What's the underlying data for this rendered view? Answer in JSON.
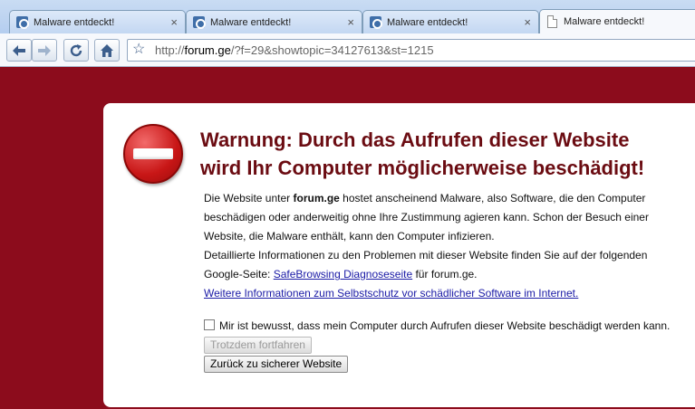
{
  "tabs": [
    {
      "label": "Malware entdeckt!",
      "active": false,
      "close": "×"
    },
    {
      "label": "Malware entdeckt!",
      "active": false,
      "close": "×"
    },
    {
      "label": "Malware entdeckt!",
      "active": false,
      "close": "×"
    },
    {
      "label": "Malware entdeckt!",
      "active": true
    }
  ],
  "toolbar": {
    "back_icon": "back-arrow-icon",
    "forward_icon": "forward-arrow-icon",
    "reload_icon": "reload-icon",
    "home_icon": "home-icon",
    "star_icon": "star-icon",
    "url_prefix": "http://",
    "url_host": "forum.ge",
    "url_path": "/?f=29&showtopic=34127613&st=1215"
  },
  "warning": {
    "headline_line1": "Warnung: Durch das Aufrufen dieser Website",
    "headline_line2": "wird Ihr Computer möglicherweise beschädigt!",
    "para1_pre": "Die Website unter ",
    "para1_host": "forum.ge",
    "para1_post": " hostet anscheinend Malware, also Software, die den Computer beschädigen oder anderweitig ohne Ihre Zustimmung agieren kann. Schon der Besuch einer Website, die Malware enthält, kann den Computer infizieren.",
    "para2_pre": "Detaillierte Informationen zu den Problemen mit dieser Website finden Sie auf der folgenden Google-Seite: ",
    "para2_link": "SafeBrowsing Diagnoseseite",
    "para2_post": " für forum.ge.",
    "more_info_link": "Weitere Informationen zum Selbstschutz vor schädlicher Software im Internet.",
    "checkbox_label": "Mir ist bewusst, dass mein Computer durch Aufrufen dieser Website beschädigt werden kann.",
    "proceed_button": "Trotzdem fortfahren",
    "back_button": "Zurück zu sicherer Website"
  },
  "colors": {
    "background": "#8c0c1c",
    "headline": "#6b0c12",
    "link": "#1a1aa6"
  }
}
